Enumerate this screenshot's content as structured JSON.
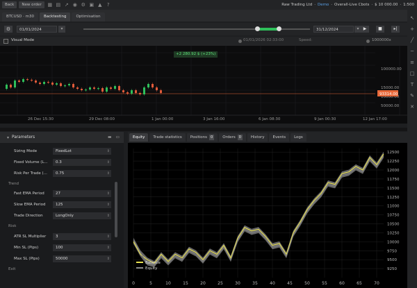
{
  "topbar": {
    "back_label": "Back",
    "new_order_label": "New order",
    "broker": "Raw Trading Ltd",
    "mode": "Demo",
    "account": "Overall-Live Cbots",
    "balance": "$ 10 000.00",
    "leverage": "1:500"
  },
  "tabs": [
    {
      "label": "BTCUSD · m30"
    },
    {
      "label": "Backtesting"
    },
    {
      "label": "Optimisation"
    }
  ],
  "dates": {
    "start": "01/01/2024",
    "end": "31/12/2024"
  },
  "visual": {
    "label": "Visual Mode",
    "time": "01/01/2026 02:33:00",
    "speed_label": "Speed:",
    "max_speed": "1000000x"
  },
  "price_chart": {
    "profit_label": "+2 280.92 $ (+23%)",
    "price_axis": [
      "100000.00",
      "15000.00",
      "10000.00",
      "50000.00"
    ],
    "current_price": "93314.00",
    "time_axis": [
      "26 Dec 15:30",
      "29 Dec 08:00",
      "1 Jan 00:00",
      "3 Jan 16:00",
      "6 Jan 08:30",
      "9 Jan 00:30",
      "12 Jan 17:00"
    ],
    "colors": {
      "up": "#2fbf5a",
      "down": "#e05a3a",
      "marker": "#e8693a"
    }
  },
  "params": {
    "title": "Parameters",
    "rows_top": [
      {
        "label": "Sizing Mode",
        "value": "FixedLot"
      },
      {
        "label": "Fixed Volume (L...",
        "value": "0.3"
      },
      {
        "label": "Risk Per Trade (...",
        "value": "0.75"
      }
    ],
    "section_trend": "Trend",
    "rows_trend": [
      {
        "label": "Fast EMA Period",
        "value": "27"
      },
      {
        "label": "Slow EMA Period",
        "value": "125"
      },
      {
        "label": "Trade Direction",
        "value": "LongOnly"
      }
    ],
    "section_risk": "Risk",
    "rows_risk": [
      {
        "label": "ATR SL Multiplier",
        "value": "3"
      },
      {
        "label": "Min SL (Pips)",
        "value": "100"
      },
      {
        "label": "Max SL (Pips)",
        "value": "50000"
      }
    ],
    "section_exit": "Exit"
  },
  "analytics_tabs": [
    {
      "label": "Equity"
    },
    {
      "label": "Trade statistics"
    },
    {
      "label": "Positions",
      "badge": "0"
    },
    {
      "label": "Orders",
      "badge": "0"
    },
    {
      "label": "History"
    },
    {
      "label": "Events"
    },
    {
      "label": "Logs"
    }
  ],
  "chart_data": {
    "type": "line",
    "title": "",
    "xlabel": "",
    "ylabel": "",
    "xlim": [
      0,
      72
    ],
    "ylim": [
      9000,
      12600
    ],
    "x_ticks": [
      0,
      5,
      10,
      15,
      20,
      25,
      30,
      35,
      40,
      45,
      50,
      55,
      60,
      65,
      70
    ],
    "y_ticks": [
      9250,
      9500,
      9750,
      10000,
      10250,
      10500,
      10750,
      11000,
      11250,
      11500,
      11750,
      12000,
      12250,
      12500
    ],
    "grid": true,
    "legend": "bottom-left",
    "series": [
      {
        "name": "Balance",
        "color": "#e8e050",
        "x": [
          0,
          2,
          4,
          6,
          8,
          10,
          12,
          14,
          16,
          18,
          20,
          22,
          24,
          26,
          28,
          30,
          32,
          34,
          36,
          38,
          40,
          42,
          44,
          46,
          48,
          50,
          52,
          54,
          56,
          58,
          60,
          62,
          64,
          66,
          68,
          70,
          72
        ],
        "values": [
          10000,
          9650,
          9500,
          9400,
          9650,
          9450,
          9650,
          9550,
          9800,
          9700,
          9500,
          9750,
          9650,
          9900,
          9550,
          10100,
          10400,
          10300,
          10350,
          10150,
          9900,
          9950,
          9650,
          10250,
          10550,
          10900,
          11150,
          11350,
          11650,
          11600,
          11900,
          11950,
          12100,
          12000,
          12350,
          12150,
          12450
        ]
      },
      {
        "name": "Equity",
        "color": "#8a8a8a",
        "x": [
          0,
          2,
          4,
          6,
          8,
          10,
          12,
          14,
          16,
          18,
          20,
          22,
          24,
          26,
          28,
          30,
          32,
          34,
          36,
          38,
          40,
          42,
          44,
          46,
          48,
          50,
          52,
          54,
          56,
          58,
          60,
          62,
          64,
          66,
          68,
          70,
          72
        ],
        "values": [
          10050,
          9700,
          9400,
          9350,
          9600,
          9400,
          9600,
          9500,
          9750,
          9650,
          9450,
          9700,
          9600,
          9850,
          9500,
          10050,
          10350,
          10250,
          10300,
          10100,
          9850,
          9900,
          9600,
          10200,
          10500,
          10850,
          11100,
          11300,
          11600,
          11550,
          11850,
          11900,
          12050,
          11950,
          12300,
          12100,
          12400
        ]
      }
    ]
  }
}
